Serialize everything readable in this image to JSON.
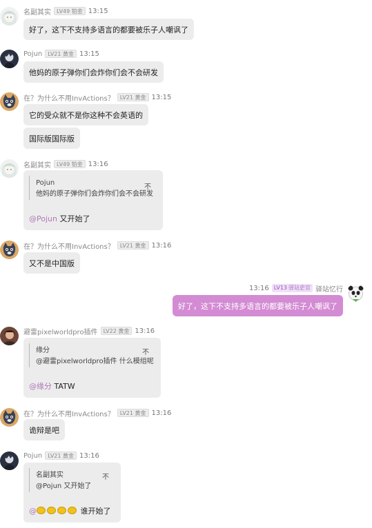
{
  "messages": [
    {
      "name": "名副其实",
      "level": "LV49 铂金",
      "time": "13:15",
      "text": "好了，这下不支持多语言的都要被乐子人嘲讽了"
    },
    {
      "name": "Pojun",
      "level": "LV21 黄金",
      "time": "13:15",
      "text": "他妈的原子弹你们会炸你们会不会研发"
    },
    {
      "name": "在？为什么不用InvActions？",
      "level": "LV21 黄金",
      "time": "13:15",
      "text": "它的受众就不是你这种不会英语的",
      "text2": "国际版国际版"
    },
    {
      "name": "名副其实",
      "level": "LV49 铂金",
      "time": "13:16",
      "quote": {
        "author": "Pojun",
        "text": "他妈的原子弹你们会炸你们会不会研发",
        "close": "不"
      },
      "mention": "@Pojun",
      "reply": "又开始了"
    },
    {
      "name": "在？为什么不用InvActions？",
      "level": "LV21 黄金",
      "time": "13:16",
      "text": "又不是中国版"
    },
    {
      "self": true,
      "time": "13:16",
      "level": "LV13",
      "role": "驿站史官",
      "name": "驿站忆行",
      "text": "好了，这下不支持多语言的都要被乐子人嘲讽了"
    },
    {
      "name": "避雷pixelworldpro插件",
      "level": "LV22 黄金",
      "time": "13:16",
      "quote": {
        "author": "缘分",
        "text": "@避雷pixelworldpro插件 什么模组呢",
        "close": "不"
      },
      "mention": "@缘分",
      "reply": "TATW"
    },
    {
      "name": "在？为什么不用InvActions？",
      "level": "LV21 黄金",
      "time": "13:16",
      "text": "诡辩是吧"
    },
    {
      "name": "Pojun",
      "level": "LV21 黄金",
      "time": "13:16",
      "quote": {
        "author": "名副其实",
        "text": "@Pojun 又开始了",
        "close": "不"
      },
      "mention": "@",
      "reply": "谁开始了"
    }
  ],
  "icons": {
    "anime-girl": "anime-girl-avatar-icon",
    "dark-figure": "dark-figure-avatar-icon",
    "cat": "cat-avatar-icon",
    "person": "person-avatar-icon",
    "panda": "panda-avatar-icon",
    "lemon": "lemon-emoji-icon"
  },
  "colors": {
    "self_bubble": "#d38bd3",
    "other_bubble": "#ececec",
    "mention": "#b07ab4"
  }
}
